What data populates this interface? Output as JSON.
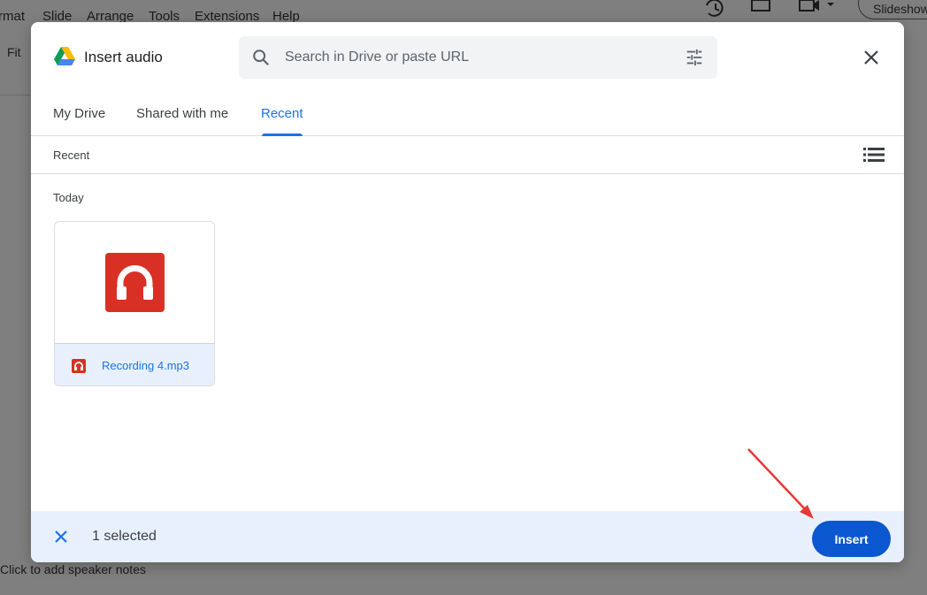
{
  "background": {
    "menu": [
      "rmat",
      "Slide",
      "Arrange",
      "Tools",
      "Extensions",
      "Help"
    ],
    "toolbar_fit": "Fit",
    "slideshow_label": "Slideshow",
    "speaker_notes": "Click to add speaker notes"
  },
  "dialog": {
    "title": "Insert audio",
    "search_placeholder": "Search in Drive or paste URL",
    "search_value": "",
    "tabs": [
      {
        "label": "My Drive",
        "active": false
      },
      {
        "label": "Shared with me",
        "active": false
      },
      {
        "label": "Recent",
        "active": true
      }
    ],
    "section_label": "Recent",
    "group_label": "Today",
    "files": [
      {
        "name": "Recording 4.mp3",
        "icon": "audio-headphones-icon",
        "selected": true
      }
    ],
    "footer": {
      "selected_count": "1 selected",
      "insert_label": "Insert"
    }
  },
  "colors": {
    "accent": "#1a73e8",
    "insert_button": "#0b57d0",
    "audio_red": "#d93025",
    "selected_bg": "#e8f0fe",
    "annotation_arrow": "#e53935"
  }
}
